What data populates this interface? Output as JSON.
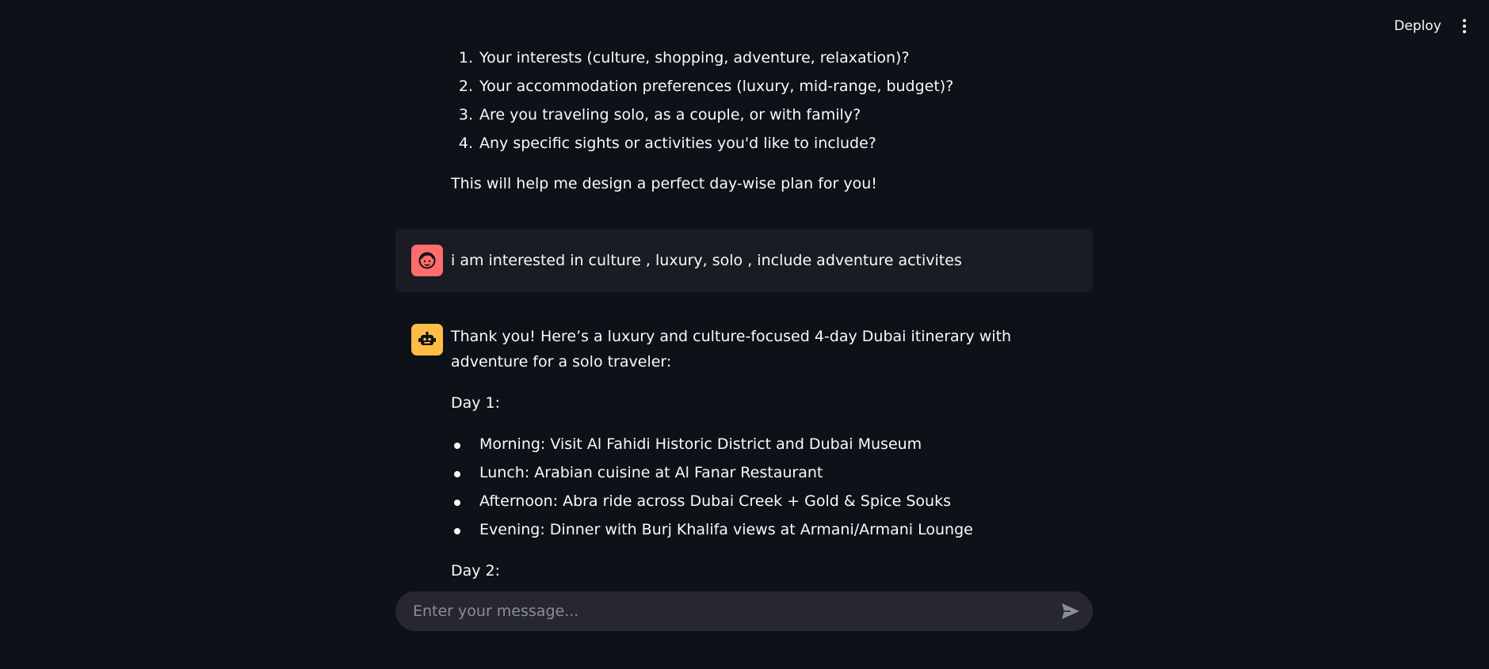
{
  "header": {
    "deploy_label": "Deploy",
    "menu_icon": "kebab-menu-icon"
  },
  "assistant_prev": {
    "numbered_items": [
      {
        "num": "1.",
        "text": "Your interests (culture, shopping, adventure, relaxation)?"
      },
      {
        "num": "2.",
        "text": "Your accommodation preferences (luxury, mid-range, budget)?"
      },
      {
        "num": "3.",
        "text": "Are you traveling solo, as a couple, or with family?"
      },
      {
        "num": "4.",
        "text": "Any specific sights or activities you'd like to include?"
      }
    ],
    "closing": "This will help me design a perfect day-wise plan for you!"
  },
  "user_message": {
    "avatar_icon": "user-face-icon",
    "text": "i am interested in culture , luxury, solo , include adventure activites"
  },
  "assistant_reply": {
    "avatar_icon": "robot-icon",
    "intro": "Thank you! Here’s a luxury and culture-focused 4-day Dubai itinerary with adventure for a solo traveler:",
    "day1_heading": "Day 1:",
    "day1_items": [
      "Morning: Visit Al Fahidi Historic District and Dubai Museum",
      "Lunch: Arabian cuisine at Al Fanar Restaurant",
      "Afternoon: Abra ride across Dubai Creek + Gold & Spice Souks",
      "Evening: Dinner with Burj Khalifa views at Armani/Armani Lounge"
    ],
    "day2_heading": "Day 2:"
  },
  "chat_input": {
    "placeholder": "Enter your message...",
    "value": "",
    "send_icon": "send-icon"
  },
  "colors": {
    "background": "#0e1117",
    "user_bubble": "#1a1c24",
    "user_avatar": "#ff6c6c",
    "bot_avatar": "#ffbd45",
    "input_bg": "#262730"
  }
}
